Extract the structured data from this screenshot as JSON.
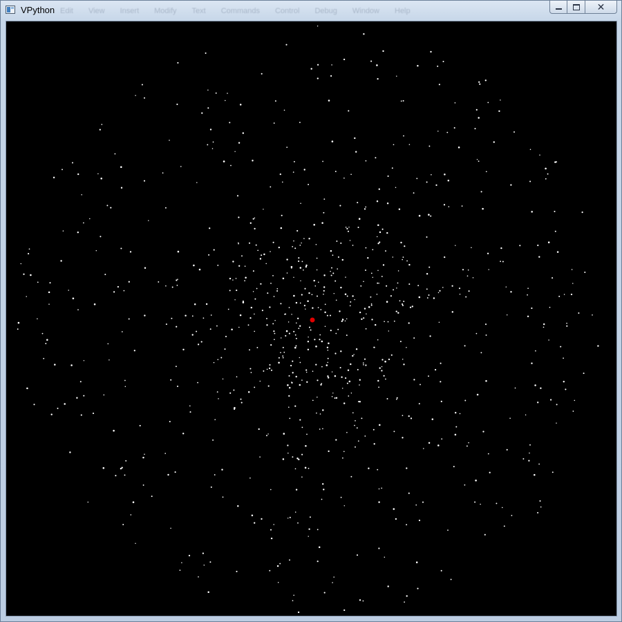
{
  "window": {
    "title": "VPython",
    "menu_ghost": [
      "Edit",
      "View",
      "Insert",
      "Modify",
      "Text",
      "Commands",
      "Control",
      "Debug",
      "Window",
      "Help"
    ],
    "buttons": {
      "minimize": "minimize",
      "maximize": "maximize",
      "close": "close"
    }
  },
  "scene": {
    "background": "#000000",
    "particle_color": "#ffffff",
    "center_body_color": "#e00000",
    "particle_count": 900
  },
  "icons": {
    "app": "app-icon",
    "minimize": "minimize-icon",
    "maximize": "maximize-icon",
    "close": "close-icon"
  }
}
